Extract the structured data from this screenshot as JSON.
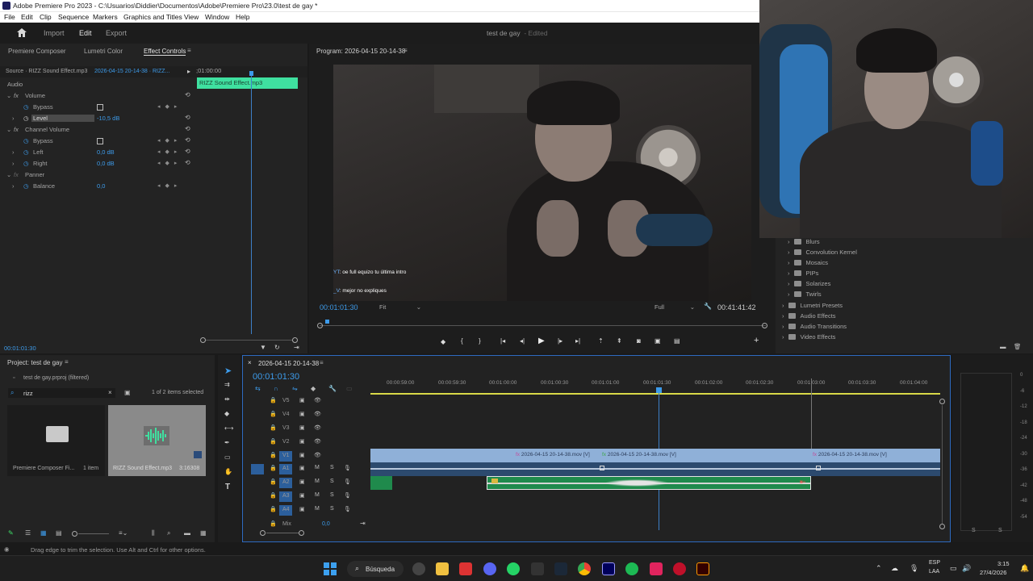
{
  "window": {
    "title": "Adobe Premiere Pro 2023 - C:\\Usuarios\\Diddier\\Documentos\\Adobe\\Premiere Pro\\23.0\\test de gay *",
    "menu": [
      "File",
      "Edit",
      "Clip",
      "Sequence",
      "Markers",
      "Graphics and Titles",
      "View",
      "Window",
      "Help"
    ]
  },
  "header": {
    "tabs": [
      "Import",
      "Edit",
      "Export"
    ],
    "active_tab": "Edit",
    "project_name": "test de gay",
    "project_state": "- Edited"
  },
  "effect_controls": {
    "tabs": [
      "Premiere Composer",
      "Lumetri Color",
      "Effect Controls"
    ],
    "source": "Source · RIZZ Sound Effect.mp3",
    "sequence": "2026-04-15 20-14-38 · RIZZ...",
    "time_start": ";01:00:00",
    "clip_label": "RIZZ Sound Effect.mp3",
    "section": "Audio",
    "rows": {
      "volume": "Volume",
      "bypass1": "Bypass",
      "level": "Level",
      "level_val": "-10,5 dB",
      "channel_volume": "Channel Volume",
      "bypass2": "Bypass",
      "left": "Left",
      "left_val": "0,0 dB",
      "right": "Right",
      "right_val": "0,0 dB",
      "panner": "Panner",
      "balance": "Balance",
      "balance_val": "0,0"
    },
    "timecode": "00:01:01:30"
  },
  "program": {
    "title": "Program: 2026-04-15 20-14-38",
    "timecode": "00:01:01:30",
    "fit": "Fit",
    "quality": "Full",
    "duration": "00:41:41:42",
    "chat": [
      {
        "user": "YT",
        "msg": ": oe full equizo tu última intro"
      },
      {
        "user": "_V",
        "msg": ": mejor no expliques"
      }
    ]
  },
  "effects": {
    "items": [
      "Blurs",
      "Convolution Kernel",
      "Mosaics",
      "PIPs",
      "Solarizes",
      "Twirls"
    ],
    "top": [
      "Lumetri Presets",
      "Audio Effects",
      "Audio Transitions",
      "Video Effects"
    ]
  },
  "project": {
    "title": "Project: test de gay",
    "path": "test de gay.prproj (filtered)",
    "search": "rizz",
    "count": "1 of 2 items selected",
    "bin_name": "Premiere Composer Fi...",
    "bin_count": "1 item",
    "file_name": "RIZZ Sound Effect.mp3",
    "file_duration": "3:16308"
  },
  "timeline": {
    "sequence_tab": "2026-04-15 20-14-38",
    "timecode": "00:01:01:30",
    "ruler": [
      "00:00:59:00",
      "00:00:59:30",
      "00:01:00:00",
      "00:01:00:30",
      "00:01:01:00",
      "00:01:01:30",
      "00:01:02:00",
      "00:01:02:30",
      "00:01:03:00",
      "00:01:03:30",
      "00:01:04:00"
    ],
    "video_tracks": [
      "V5",
      "V4",
      "V3",
      "V2",
      "V1"
    ],
    "audio_tracks": [
      "A1",
      "A2",
      "A3",
      "A4"
    ],
    "mix_label": "Mix",
    "mix_val": "0,0",
    "clips": [
      "2026-04-15 20-14-38.mov [V]",
      "2026-04-15 20-14-38.mov [V]",
      "2026-04-15 20-14-38.mov [V]"
    ]
  },
  "meters": {
    "db": [
      "0",
      "-6",
      "-12",
      "-18",
      "-24",
      "-30",
      "-36",
      "-42",
      "-48",
      "-54"
    ],
    "solo": "S"
  },
  "status": "Drag edge to trim the selection. Use Alt and Ctrl for other options.",
  "taskbar": {
    "search": "Búsqueda",
    "lang": "ESP",
    "region": "LAA",
    "time": "3:15",
    "date": "27/4/2026"
  },
  "colors": {
    "accent": "#3d9bea",
    "clip_video": "#8fb0d8",
    "clip_audio": "#1f8a4c",
    "label_green": "#3fe0a0"
  }
}
